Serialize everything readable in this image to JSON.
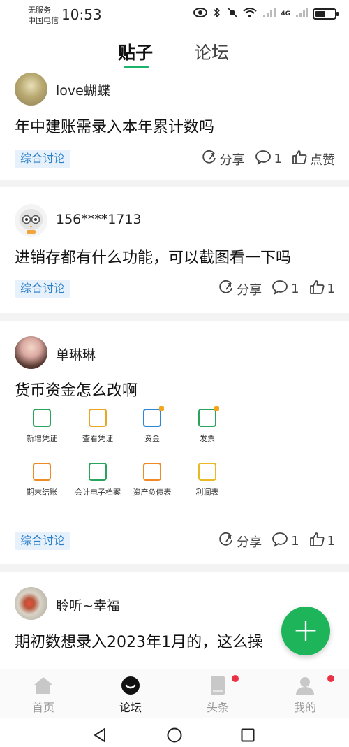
{
  "status_bar": {
    "carrier_line1": "无服务",
    "carrier_line2": "中国电信",
    "time": "10:53",
    "network": "4G"
  },
  "tabs": [
    {
      "label": "贴子",
      "active": true
    },
    {
      "label": "论坛",
      "active": false
    }
  ],
  "posts": [
    {
      "user": "love蝴蝶",
      "title": "年中建账需录入本年累计数吗",
      "tag": "综合讨论",
      "share_label": "分享",
      "comments": "1",
      "like_label": "点赞"
    },
    {
      "user": "156****1713",
      "title": "进销存都有什么功能，可以截图看一下吗",
      "tag": "综合讨论",
      "share_label": "分享",
      "comments": "1",
      "likes": "1"
    },
    {
      "user": "单琳琳",
      "title": "货币资金怎么改啊",
      "tag": "综合讨论",
      "share_label": "分享",
      "comments": "1",
      "likes": "1",
      "image_grid": [
        {
          "label": "新增凭证",
          "icon": "add-voucher-icon",
          "color": "#2aa35c"
        },
        {
          "label": "查看凭证",
          "icon": "view-voucher-icon",
          "color": "#e8a623"
        },
        {
          "label": "资金",
          "icon": "funds-icon",
          "color": "#2d86d6"
        },
        {
          "label": "发票",
          "icon": "invoice-icon",
          "color": "#2aa35c"
        },
        {
          "label": "期末结账",
          "icon": "period-close-icon",
          "color": "#f08a24"
        },
        {
          "label": "会计电子档案",
          "icon": "e-archive-icon",
          "color": "#2aa35c"
        },
        {
          "label": "资产负债表",
          "icon": "balance-sheet-icon",
          "color": "#f08a24"
        },
        {
          "label": "利润表",
          "icon": "profit-chart-icon",
          "color": "#e8b923"
        }
      ]
    },
    {
      "user": "聆听~幸福",
      "title": "期初数想录入2023年1月的，这么操"
    }
  ],
  "fab": {
    "label": "+"
  },
  "bottom_nav": [
    {
      "label": "首页",
      "icon": "home-icon",
      "active": false
    },
    {
      "label": "论坛",
      "icon": "forum-icon",
      "active": true
    },
    {
      "label": "头条",
      "icon": "headlines-icon",
      "active": false,
      "badge": true
    },
    {
      "label": "我的",
      "icon": "profile-icon",
      "active": false,
      "badge": true
    }
  ],
  "colors": {
    "accent": "#19b36b",
    "tag_text": "#2a7fc9",
    "tag_bg": "#e6f1fb",
    "fab": "#1db45a",
    "badge": "#ea3246"
  }
}
